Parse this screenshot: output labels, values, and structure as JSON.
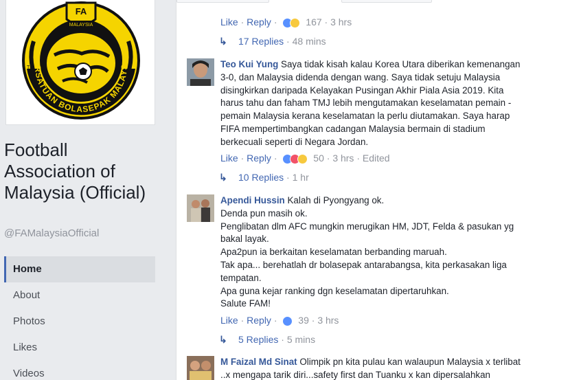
{
  "page": {
    "name": "Football Association of Malaysia (Official)",
    "handle": "@FAMalaysiaOfficial",
    "logo_text_top": "FA",
    "logo_text_inner": "MALAYSIA",
    "logo_text_ring": "PERSATUAN BOLASEPAK MALAYSIA",
    "logo_tm": "TM"
  },
  "nav": [
    {
      "label": "Home",
      "active": true
    },
    {
      "label": "About"
    },
    {
      "label": "Photos"
    },
    {
      "label": "Likes"
    },
    {
      "label": "Videos"
    }
  ],
  "comments": [
    {
      "actions": {
        "like": "Like",
        "sep": "·",
        "reply": "Reply",
        "count": "167",
        "time": "3 hrs"
      },
      "replies": {
        "label": "17 Replies",
        "time": "48 mins"
      }
    },
    {
      "author": "Teo Kui Yung",
      "lines": [
        "Saya tidak kisah kalau Korea Utara diberikan kemenangan",
        "3-0, dan Malaysia didenda dengan wang. Saya tidak setuju Malaysia",
        "disingkirkan daripada Kelayakan Pusingan Akhir Piala Asia 2019. Kita",
        "harus tahu dan faham TMJ lebih mengutamakan keselamatan pemain -",
        "pemain Malaysia kerana keselamatan la perlu diutamakan. Saya harap",
        "FIFA mempertimbangkan cadangan Malaysia bermain di stadium",
        "berkecuali seperti di Negara Jordan."
      ],
      "actions": {
        "like": "Like",
        "sep": "·",
        "reply": "Reply",
        "count": "50",
        "time": "3 hrs",
        "edited": "Edited"
      },
      "replies": {
        "label": "10 Replies",
        "time": "1 hr"
      }
    },
    {
      "author": "Apendi Hussin",
      "lines": [
        "Kalah di Pyongyang ok.",
        "Denda pun masih ok.",
        "Penglibatan dlm AFC mungkin merugikan HM, JDT, Felda & pasukan yg",
        "bakal layak.",
        "Apa2pun ia berkaitan keselamatan berbanding maruah.",
        "Tak apa... berehatlah dr bolasepak antarabangsa, kita perkasakan liga",
        "tempatan.",
        "Apa guna kejar ranking dgn keselamatan dipertaruhkan.",
        "Salute FAM!"
      ],
      "actions": {
        "like": "Like",
        "sep": "·",
        "reply": "Reply",
        "count": "39",
        "time": "3 hrs"
      },
      "replies": {
        "label": "5 Replies",
        "time": "5 mins"
      }
    },
    {
      "author": "M Faizal Md Sinat",
      "lines": [
        "Olimpik pn kita pulau kan walaupun Malaysia x terlibat",
        "..x mengapa tarik diri...safety first dan Tuanku x kan dipersalahkan"
      ]
    }
  ],
  "colors": {
    "link": "#365899",
    "like_blue": "#4267b2",
    "meta_gray": "#90949c",
    "logo_yellow": "#f5d400",
    "logo_black": "#111111"
  },
  "icons": [
    "reply-arrow-icon",
    "like-reaction-icon",
    "haha-reaction-icon",
    "love-reaction-icon"
  ]
}
